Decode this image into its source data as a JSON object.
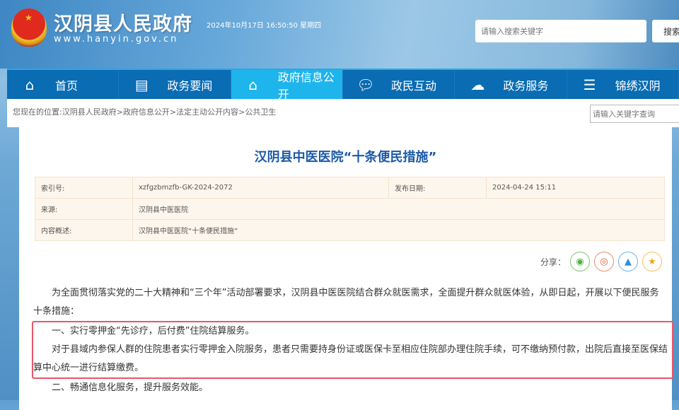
{
  "header": {
    "site_title": "汉阴县人民政府",
    "site_url": "www.hanyin.gov.cn",
    "datetime": "2024年10月17日 16:50:50 星期四",
    "search_placeholder": "请输入搜索关键字",
    "search_button": "搜索"
  },
  "nav": [
    {
      "label": "首页",
      "icon": "home-icon"
    },
    {
      "label": "政务要闻",
      "icon": "newspaper-icon"
    },
    {
      "label": "政府信息公开",
      "icon": "home-icon"
    },
    {
      "label": "政民互动",
      "icon": "chat-icon"
    },
    {
      "label": "政务服务",
      "icon": "cloud-icon"
    },
    {
      "label": "锦绣汉阴",
      "icon": "menu-icon"
    }
  ],
  "breadcrumb": "您现在的位置:汉阴县人民政府>政府信息公开>法定主动公开内容>公共卫生",
  "keyword_placeholder": "请输入关键字查询",
  "article": {
    "title": "汉阴县中医医院“十条便民措施”",
    "meta": {
      "index_label": "索引号:",
      "index_value": "xzfgzbmzfb-GK-2024-2072",
      "date_label": "发布日期:",
      "date_value": "2024-04-24 15:11",
      "source_label": "来源:",
      "source_value": "汉阴县中医医院",
      "summary_label": "内容概述:",
      "summary_value": "汉阴县中医医院“十条便民措施”"
    },
    "share_label": "分享：",
    "paragraphs": [
      "为全面贯彻落实党的二十大精神和“三个年”活动部署要求，汉阴县中医医院结合群众就医需求，全面提升群众就医体验，从即日起，开展以下便民服务十条措施：",
      "一、实行零押金“先诊疗，后付费”住院结算服务。",
      "对于县域内参保人群的住院患者实行零押金入院服务，患者只需要持身份证或医保卡至相应住院部办理住院手续，可不缴纳预付款，出院后直接至医保结算中心统一进行结算缴费。",
      "二、畅通信息化服务，提升服务效能。"
    ]
  }
}
